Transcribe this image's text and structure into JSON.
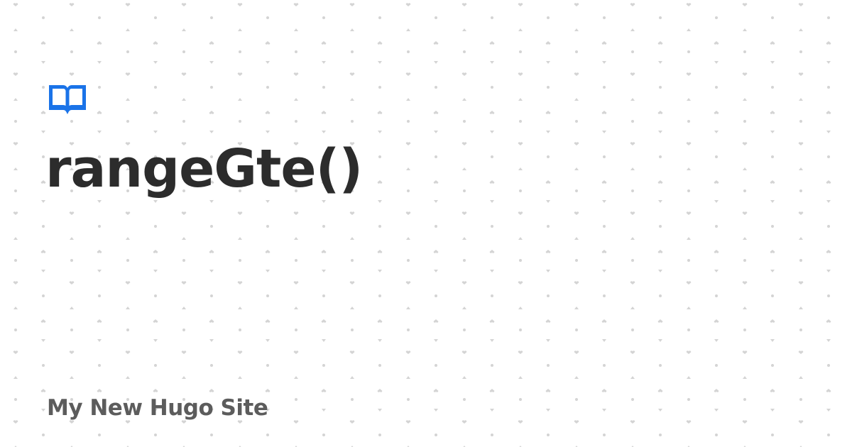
{
  "page": {
    "title": "rangeGte()",
    "site_name": "My New Hugo Site"
  },
  "logo": {
    "icon": "open-book-icon",
    "color": "#1a73e8"
  },
  "colors": {
    "background": "#ffffff",
    "pattern": "#d4d4d4",
    "title": "#2c2c2c",
    "site_name": "#5c5c5c"
  }
}
